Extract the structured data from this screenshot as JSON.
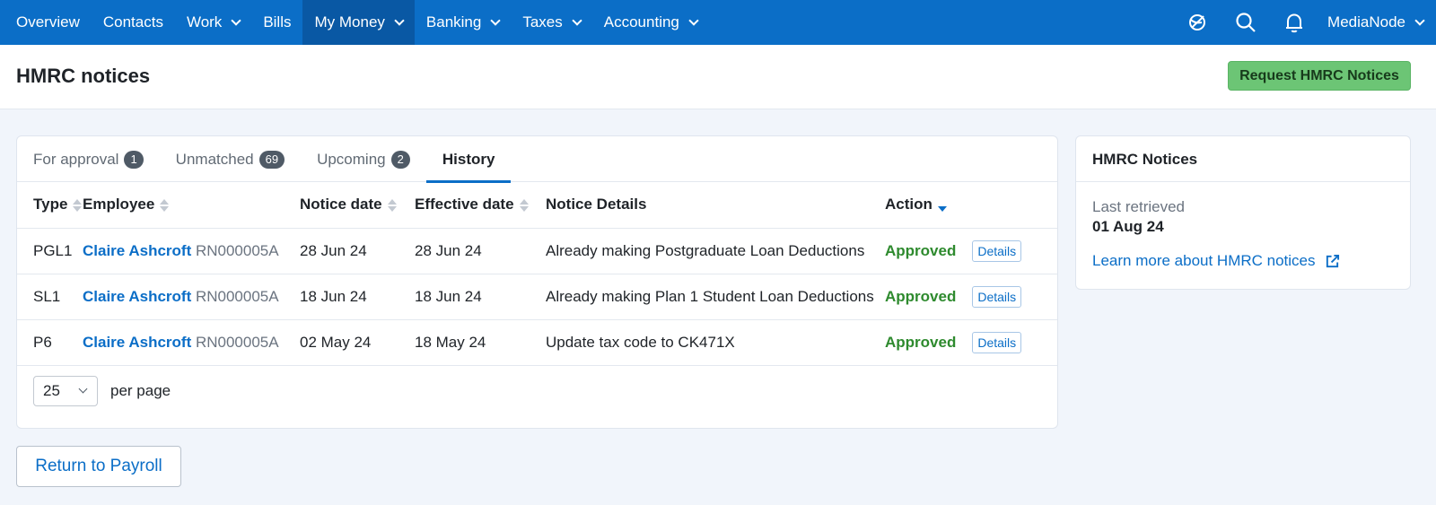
{
  "nav": {
    "items": [
      {
        "label": "Overview",
        "has_dropdown": false,
        "active": false
      },
      {
        "label": "Contacts",
        "has_dropdown": false,
        "active": false
      },
      {
        "label": "Work",
        "has_dropdown": true,
        "active": false
      },
      {
        "label": "Bills",
        "has_dropdown": false,
        "active": false
      },
      {
        "label": "My Money",
        "has_dropdown": true,
        "active": true
      },
      {
        "label": "Banking",
        "has_dropdown": true,
        "active": false
      },
      {
        "label": "Taxes",
        "has_dropdown": true,
        "active": false
      },
      {
        "label": "Accounting",
        "has_dropdown": true,
        "active": false
      }
    ],
    "icons": [
      "rocket-icon",
      "search-icon",
      "bell-icon"
    ],
    "org_name": "MediaNode",
    "color": "#0b6ec7",
    "active_color": "#0958a4"
  },
  "page": {
    "title": "HMRC notices",
    "request_button": "Request HMRC Notices"
  },
  "tabs": [
    {
      "label": "For approval",
      "count": "1",
      "active": false
    },
    {
      "label": "Unmatched",
      "count": "69",
      "active": false
    },
    {
      "label": "Upcoming",
      "count": "2",
      "active": false
    },
    {
      "label": "History",
      "count": null,
      "active": true
    }
  ],
  "table": {
    "headers": {
      "type": "Type",
      "employee": "Employee",
      "notice_date": "Notice date",
      "effective_date": "Effective date",
      "notice_details": "Notice Details",
      "action": "Action"
    },
    "sorted_column": "action",
    "sort_direction": "desc",
    "rows": [
      {
        "type": "PGL1",
        "employee_name": "Claire Ashcroft",
        "employee_ref": "RN000005A",
        "notice_date": "28 Jun 24",
        "effective_date": "28 Jun 24",
        "details": "Already making Postgraduate Loan Deductions",
        "status": "Approved",
        "details_button": "Details"
      },
      {
        "type": "SL1",
        "employee_name": "Claire Ashcroft",
        "employee_ref": "RN000005A",
        "notice_date": "18 Jun 24",
        "effective_date": "18 Jun 24",
        "details": "Already making Plan 1 Student Loan Deductions",
        "status": "Approved",
        "details_button": "Details"
      },
      {
        "type": "P6",
        "employee_name": "Claire Ashcroft",
        "employee_ref": "RN000005A",
        "notice_date": "02 May 24",
        "effective_date": "18 May 24",
        "details": "Update tax code to CK471X",
        "status": "Approved",
        "details_button": "Details"
      }
    ]
  },
  "pagination": {
    "per_page_value": "25",
    "per_page_label": "per page"
  },
  "return_button": "Return to Payroll",
  "side_panel": {
    "title": "HMRC Notices",
    "last_retrieved_label": "Last retrieved",
    "last_retrieved_value": "01 Aug 24",
    "learn_more_link": "Learn more about HMRC notices",
    "link_icon": "external-link-icon"
  },
  "colors": {
    "accent": "#0b6ec7",
    "approved": "#2e8a2e",
    "request_button_bg": "#6cc575"
  }
}
